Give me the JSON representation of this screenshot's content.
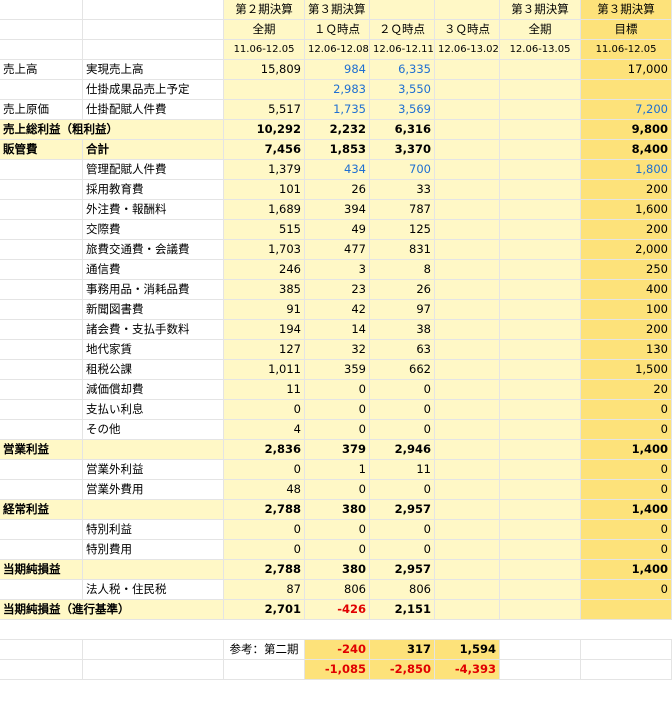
{
  "header": {
    "row1": [
      "",
      "",
      "第２期決算",
      "第３期決算",
      "",
      "",
      "第３期決算",
      "第３期決算"
    ],
    "row2": [
      "",
      "",
      "全期",
      "１Ｑ時点",
      "２Ｑ時点",
      "３Ｑ時点",
      "全期",
      "目標"
    ],
    "row3": [
      "",
      "",
      "11.06-12.05",
      "12.06-12.08",
      "12.06-12.11",
      "12.06-13.02",
      "12.06-13.05",
      "11.06-12.05"
    ]
  },
  "rows": [
    {
      "a": "売上高",
      "b": "実現売上高",
      "c": "15,809",
      "d": "984",
      "e": "6,335",
      "f": "",
      "g": "",
      "h": "17,000",
      "blue": [
        "d",
        "e"
      ]
    },
    {
      "a": "",
      "b": "仕掛成果品売上予定",
      "c": "",
      "d": "2,983",
      "e": "3,550",
      "f": "",
      "g": "",
      "h": "",
      "blue": [
        "d",
        "e"
      ]
    },
    {
      "a": "売上原価",
      "b": "仕掛配賦人件費",
      "c": "5,517",
      "d": "1,735",
      "e": "3,569",
      "f": "",
      "g": "",
      "h": "7,200",
      "blue": [
        "d",
        "e",
        "h"
      ]
    },
    {
      "a": "売上総利益（粗利益）",
      "b": "",
      "c": "10,292",
      "d": "2,232",
      "e": "6,316",
      "f": "",
      "g": "",
      "h": "9,800",
      "bold": true,
      "span": true
    },
    {
      "a": "販管費",
      "b": "合計",
      "c": "7,456",
      "d": "1,853",
      "e": "3,370",
      "f": "",
      "g": "",
      "h": "8,400",
      "bold": true,
      "span2": true
    },
    {
      "a": "",
      "b": "管理配賦人件費",
      "c": "1,379",
      "d": "434",
      "e": "700",
      "f": "",
      "g": "",
      "h": "1,800",
      "blue": [
        "d",
        "e",
        "h"
      ]
    },
    {
      "a": "",
      "b": "採用教育費",
      "c": "101",
      "d": "26",
      "e": "33",
      "f": "",
      "g": "",
      "h": "200"
    },
    {
      "a": "",
      "b": "外注費・報酬料",
      "c": "1,689",
      "d": "394",
      "e": "787",
      "f": "",
      "g": "",
      "h": "1,600"
    },
    {
      "a": "",
      "b": "交際費",
      "c": "515",
      "d": "49",
      "e": "125",
      "f": "",
      "g": "",
      "h": "200"
    },
    {
      "a": "",
      "b": "旅費交通費・会議費",
      "c": "1,703",
      "d": "477",
      "e": "831",
      "f": "",
      "g": "",
      "h": "2,000"
    },
    {
      "a": "",
      "b": "通信費",
      "c": "246",
      "d": "3",
      "e": "8",
      "f": "",
      "g": "",
      "h": "250"
    },
    {
      "a": "",
      "b": "事務用品・消耗品費",
      "c": "385",
      "d": "23",
      "e": "26",
      "f": "",
      "g": "",
      "h": "400"
    },
    {
      "a": "",
      "b": "新聞図書費",
      "c": "91",
      "d": "42",
      "e": "97",
      "f": "",
      "g": "",
      "h": "100"
    },
    {
      "a": "",
      "b": "諸会費・支払手数料",
      "c": "194",
      "d": "14",
      "e": "38",
      "f": "",
      "g": "",
      "h": "200"
    },
    {
      "a": "",
      "b": "地代家賃",
      "c": "127",
      "d": "32",
      "e": "63",
      "f": "",
      "g": "",
      "h": "130"
    },
    {
      "a": "",
      "b": "租税公課",
      "c": "1,011",
      "d": "359",
      "e": "662",
      "f": "",
      "g": "",
      "h": "1,500"
    },
    {
      "a": "",
      "b": "減価償却費",
      "c": "11",
      "d": "0",
      "e": "0",
      "f": "",
      "g": "",
      "h": "20"
    },
    {
      "a": "",
      "b": "支払い利息",
      "c": "0",
      "d": "0",
      "e": "0",
      "f": "",
      "g": "",
      "h": "0"
    },
    {
      "a": "",
      "b": "その他",
      "c": "4",
      "d": "0",
      "e": "0",
      "f": "",
      "g": "",
      "h": "0"
    },
    {
      "a": "営業利益",
      "b": "",
      "c": "2,836",
      "d": "379",
      "e": "2,946",
      "f": "",
      "g": "",
      "h": "1,400",
      "bold": true,
      "yellow": true
    },
    {
      "a": "",
      "b": "営業外利益",
      "c": "0",
      "d": "1",
      "e": "11",
      "f": "",
      "g": "",
      "h": "0"
    },
    {
      "a": "",
      "b": "営業外費用",
      "c": "48",
      "d": "0",
      "e": "0",
      "f": "",
      "g": "",
      "h": "0"
    },
    {
      "a": "経常利益",
      "b": "",
      "c": "2,788",
      "d": "380",
      "e": "2,957",
      "f": "",
      "g": "",
      "h": "1,400",
      "bold": true,
      "yellow": true
    },
    {
      "a": "",
      "b": "特別利益",
      "c": "0",
      "d": "0",
      "e": "0",
      "f": "",
      "g": "",
      "h": "0"
    },
    {
      "a": "",
      "b": "特別費用",
      "c": "0",
      "d": "0",
      "e": "0",
      "f": "",
      "g": "",
      "h": "0"
    },
    {
      "a": "当期純損益",
      "b": "",
      "c": "2,788",
      "d": "380",
      "e": "2,957",
      "f": "",
      "g": "",
      "h": "1,400",
      "bold": true,
      "yellow": true
    },
    {
      "a": "",
      "b": "法人税・住民税",
      "c": "87",
      "d": "806",
      "e": "806",
      "f": "",
      "g": "",
      "h": "0"
    },
    {
      "a": "当期純損益（進行基準）",
      "b": "",
      "c": "2,701",
      "d": "-426",
      "e": "2,151",
      "f": "",
      "g": "",
      "h": "",
      "bold": true,
      "yellow": true,
      "span": true,
      "red": [
        "d"
      ]
    }
  ],
  "footer": {
    "ref_label": "参考：第二期",
    "r1": [
      "-240",
      "317",
      "1,594"
    ],
    "r2": [
      "-1,085",
      "-2,850",
      "-4,393"
    ]
  }
}
